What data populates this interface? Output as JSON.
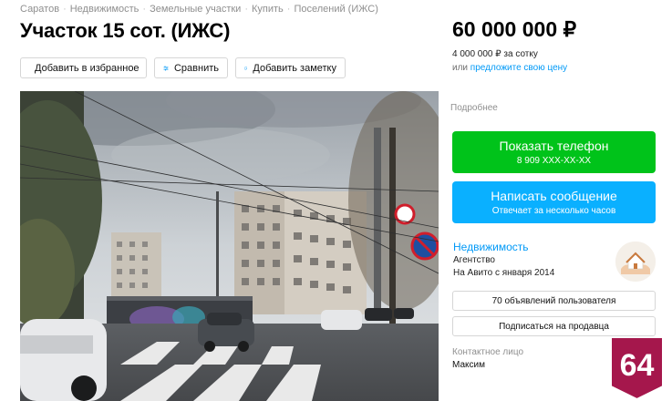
{
  "breadcrumbs": [
    "Саратов",
    "Недвижимость",
    "Земельные участки",
    "Купить",
    "Поселений (ИЖС)"
  ],
  "title": "Участок 15 сот. (ИЖС)",
  "actions": {
    "favorite": "Добавить в избранное",
    "compare": "Сравнить",
    "note": "Добавить заметку"
  },
  "price": {
    "value": "60 000 000 ₽",
    "per_unit": "4 000 000 ₽ за сотку",
    "or_text": "или",
    "suggest_link": "предложите свою цену"
  },
  "details_link": "Подробнее",
  "call_button": {
    "label": "Показать телефон",
    "phone": "8 909 XXX-XX-XX"
  },
  "message_button": {
    "label": "Написать сообщение",
    "sub": "Отвечает за несколько часов"
  },
  "seller": {
    "name": "Недвижимость",
    "type": "Агентство",
    "since": "На Авито с января 2014",
    "ads_button": "70 объявлений пользователя",
    "subscribe_button": "Подписаться на продавца"
  },
  "contact": {
    "label": "Контактное лицо",
    "name": "Максим"
  },
  "badge": {
    "number": "64"
  },
  "colors": {
    "green": "#00c31a",
    "blue": "#0ab0ff",
    "link": "#0099f7",
    "badge": "#a5174c"
  },
  "icons": [
    "heart-icon",
    "compare-icon",
    "note-icon"
  ]
}
